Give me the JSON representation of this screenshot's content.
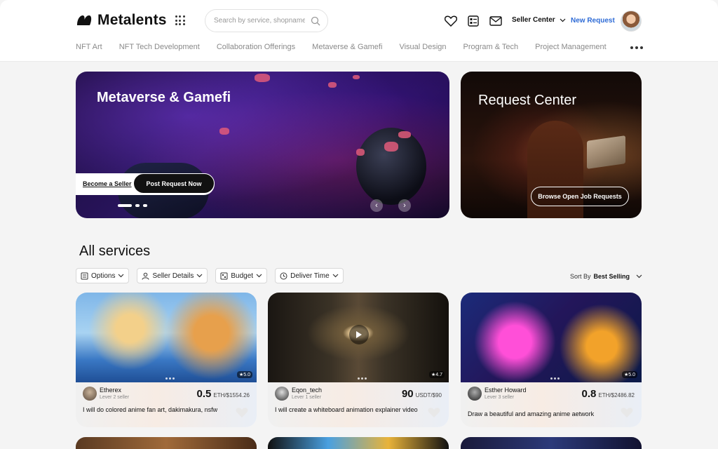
{
  "app": {
    "logo_text": "Metalents",
    "search_placeholder": "Search by service, shopname",
    "seller_center": "Seller Center",
    "new_request": "New Request"
  },
  "nav": [
    "NFT Art",
    "NFT Tech Development",
    "Collaboration Offerings",
    "Metaverse & Gamefi",
    "Visual Design",
    "Program & Tech",
    "Project Management"
  ],
  "hero": {
    "title": "Metaverse & Gamefi",
    "become_seller": "Become a Seller",
    "post_request": "Post Request Now"
  },
  "side_banner": {
    "title": "Request Center",
    "button": "Browse Open Job Requests"
  },
  "services": {
    "title": "All services",
    "filters": [
      "Options",
      "Seller Details",
      "Budget",
      "Deliver Time"
    ],
    "sort_label": "Sort By",
    "sort_value": "Best Selling"
  },
  "cards": [
    {
      "seller": "Etherex",
      "level": "Lever 2 seller",
      "price": "0.5",
      "price_sub": "ETH/$1554.26",
      "rating": "★5.0",
      "desc": "I will do colored anime fan art, dakimakura, nsfw"
    },
    {
      "seller": "Eqon_tech",
      "level": "Lever 1 seller",
      "price": "90",
      "price_sub": "USDT/$90",
      "rating": "★4.7",
      "desc": "I will create a whiteboard animation explainer video"
    },
    {
      "seller": "Esther Howard",
      "level": "Lever 3 seller",
      "price": "0.8",
      "price_sub": "ETH/$2486.82",
      "rating": "★5.0",
      "desc": "Draw a beautiful and amazing anime aetwork"
    }
  ],
  "colors": {
    "accent_link": "#2e6bd6",
    "dark": "#111111",
    "page_bg": "#f4f4f4"
  }
}
